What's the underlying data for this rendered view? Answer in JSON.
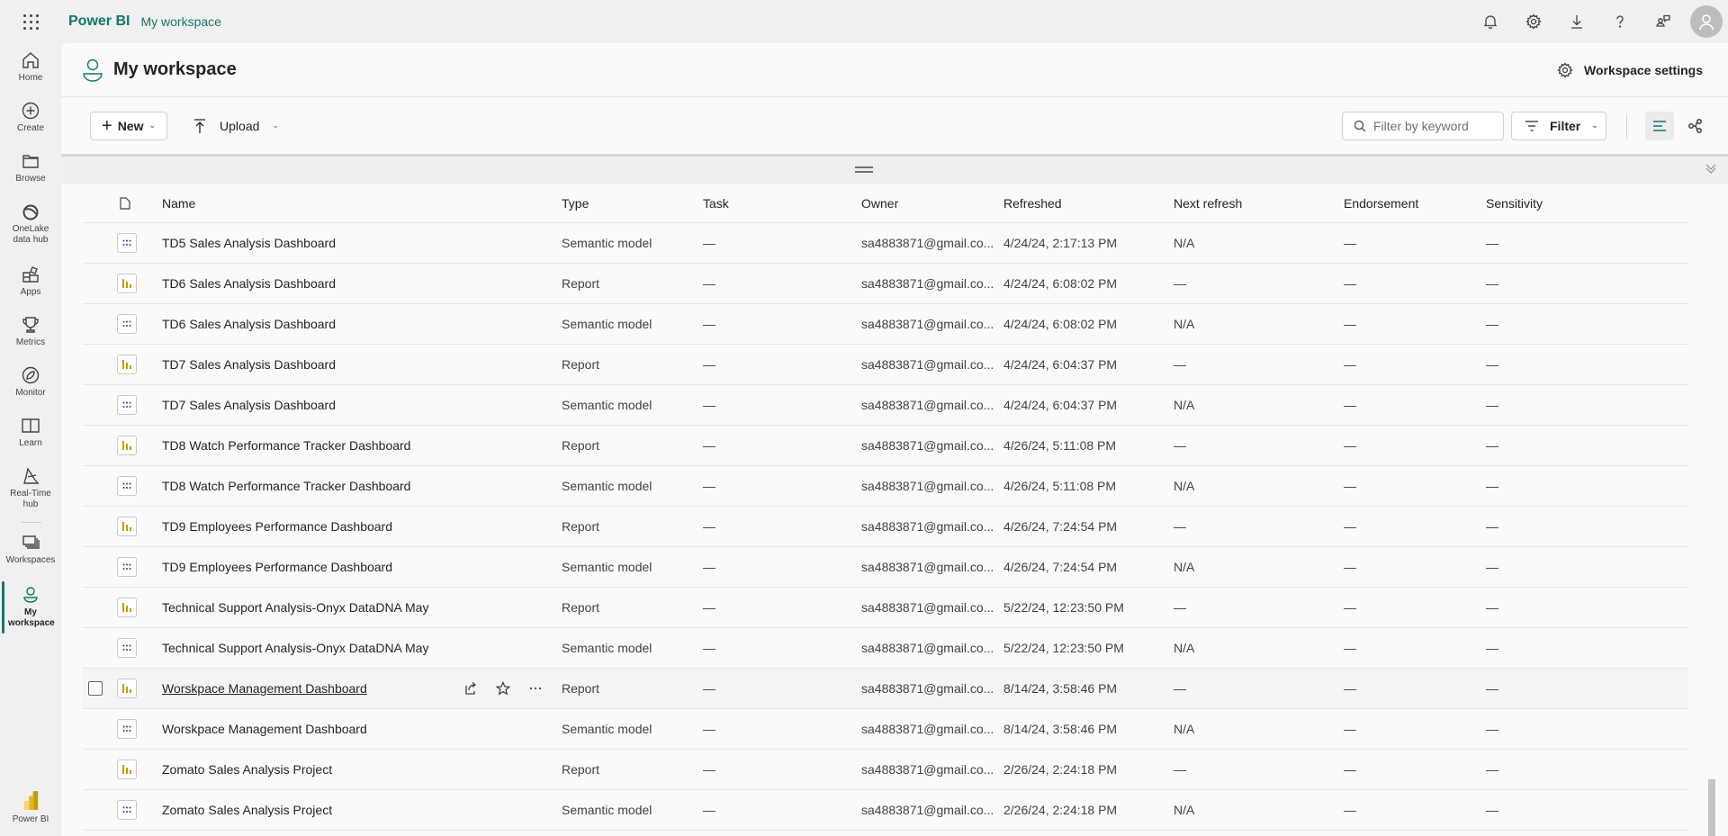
{
  "topbar": {
    "brand": "Power BI",
    "breadcrumb": "My workspace",
    "icons": [
      "bell-icon",
      "gear-icon",
      "download-icon",
      "help-icon",
      "feedback-icon",
      "account-avatar"
    ]
  },
  "leftnav": {
    "items": [
      {
        "label": "Home",
        "icon": "home-icon"
      },
      {
        "label": "Create",
        "icon": "create-icon"
      },
      {
        "label": "Browse",
        "icon": "folder-icon"
      },
      {
        "label": "OneLake data hub",
        "icon": "onelake-icon"
      },
      {
        "label": "Apps",
        "icon": "apps-icon"
      },
      {
        "label": "Metrics",
        "icon": "trophy-icon"
      },
      {
        "label": "Monitor",
        "icon": "monitor-icon"
      },
      {
        "label": "Learn",
        "icon": "book-icon"
      },
      {
        "label": "Real-Time hub",
        "icon": "realtime-icon"
      },
      {
        "label": "Workspaces",
        "icon": "workspaces-icon"
      },
      {
        "label": "My workspace",
        "icon": "person-icon",
        "active": true
      }
    ],
    "footer_label": "Power BI"
  },
  "workspace": {
    "title": "My workspace",
    "settings_label": "Workspace settings"
  },
  "toolbar": {
    "new_label": "New",
    "upload_label": "Upload",
    "search_placeholder": "Filter by keyword",
    "search_value": "",
    "filter_label": "Filter"
  },
  "table": {
    "columns": [
      "Name",
      "Type",
      "Task",
      "Owner",
      "Refreshed",
      "Next refresh",
      "Endorsement",
      "Sensitivity"
    ],
    "rows": [
      {
        "name": "TD5 Sales Analysis Dashboard",
        "type": "Semantic model",
        "task": "—",
        "owner": "sa4883871@gmail.co...",
        "refreshed": "4/24/24, 2:17:13 PM",
        "next": "N/A",
        "endorsement": "—",
        "sensitivity": "—"
      },
      {
        "name": "TD6 Sales Analysis Dashboard",
        "type": "Report",
        "task": "—",
        "owner": "sa4883871@gmail.co...",
        "refreshed": "4/24/24, 6:08:02 PM",
        "next": "—",
        "endorsement": "—",
        "sensitivity": "—"
      },
      {
        "name": "TD6 Sales Analysis Dashboard",
        "type": "Semantic model",
        "task": "—",
        "owner": "sa4883871@gmail.co...",
        "refreshed": "4/24/24, 6:08:02 PM",
        "next": "N/A",
        "endorsement": "—",
        "sensitivity": "—"
      },
      {
        "name": "TD7 Sales Analysis Dashboard",
        "type": "Report",
        "task": "—",
        "owner": "sa4883871@gmail.co...",
        "refreshed": "4/24/24, 6:04:37 PM",
        "next": "—",
        "endorsement": "—",
        "sensitivity": "—"
      },
      {
        "name": "TD7 Sales Analysis Dashboard",
        "type": "Semantic model",
        "task": "—",
        "owner": "sa4883871@gmail.co...",
        "refreshed": "4/24/24, 6:04:37 PM",
        "next": "N/A",
        "endorsement": "—",
        "sensitivity": "—"
      },
      {
        "name": "TD8 Watch Performance Tracker Dashboard",
        "type": "Report",
        "task": "—",
        "owner": "sa4883871@gmail.co...",
        "refreshed": "4/26/24, 5:11:08 PM",
        "next": "—",
        "endorsement": "—",
        "sensitivity": "—"
      },
      {
        "name": "TD8 Watch Performance Tracker Dashboard",
        "type": "Semantic model",
        "task": "—",
        "owner": "sa4883871@gmail.co...",
        "refreshed": "4/26/24, 5:11:08 PM",
        "next": "N/A",
        "endorsement": "—",
        "sensitivity": "—"
      },
      {
        "name": "TD9 Employees Performance Dashboard",
        "type": "Report",
        "task": "—",
        "owner": "sa4883871@gmail.co...",
        "refreshed": "4/26/24, 7:24:54 PM",
        "next": "—",
        "endorsement": "—",
        "sensitivity": "—"
      },
      {
        "name": "TD9 Employees Performance Dashboard",
        "type": "Semantic model",
        "task": "—",
        "owner": "sa4883871@gmail.co...",
        "refreshed": "4/26/24, 7:24:54 PM",
        "next": "N/A",
        "endorsement": "—",
        "sensitivity": "—"
      },
      {
        "name": "Technical Support Analysis-Onyx DataDNA May",
        "type": "Report",
        "task": "—",
        "owner": "sa4883871@gmail.co...",
        "refreshed": "5/22/24, 12:23:50 PM",
        "next": "—",
        "endorsement": "—",
        "sensitivity": "—"
      },
      {
        "name": "Technical Support Analysis-Onyx DataDNA May",
        "type": "Semantic model",
        "task": "—",
        "owner": "sa4883871@gmail.co...",
        "refreshed": "5/22/24, 12:23:50 PM",
        "next": "N/A",
        "endorsement": "—",
        "sensitivity": "—"
      },
      {
        "name": "Worskpace Management Dashboard",
        "type": "Report",
        "task": "—",
        "owner": "sa4883871@gmail.co...",
        "refreshed": "8/14/24, 3:58:46 PM",
        "next": "—",
        "endorsement": "—",
        "sensitivity": "—",
        "hover": true
      },
      {
        "name": "Worskpace Management Dashboard",
        "type": "Semantic model",
        "task": "—",
        "owner": "sa4883871@gmail.co...",
        "refreshed": "8/14/24, 3:58:46 PM",
        "next": "N/A",
        "endorsement": "—",
        "sensitivity": "—"
      },
      {
        "name": "Zomato Sales Analysis Project",
        "type": "Report",
        "task": "—",
        "owner": "sa4883871@gmail.co...",
        "refreshed": "2/26/24, 2:24:18 PM",
        "next": "—",
        "endorsement": "—",
        "sensitivity": "—"
      },
      {
        "name": "Zomato Sales Analysis Project",
        "type": "Semantic model",
        "task": "—",
        "owner": "sa4883871@gmail.co...",
        "refreshed": "2/26/24, 2:24:18 PM",
        "next": "N/A",
        "endorsement": "—",
        "sensitivity": "—"
      }
    ]
  },
  "colors": {
    "accent": "#117865",
    "report_icon": "#c19c00",
    "semantic_icon": "#5c2e91"
  }
}
